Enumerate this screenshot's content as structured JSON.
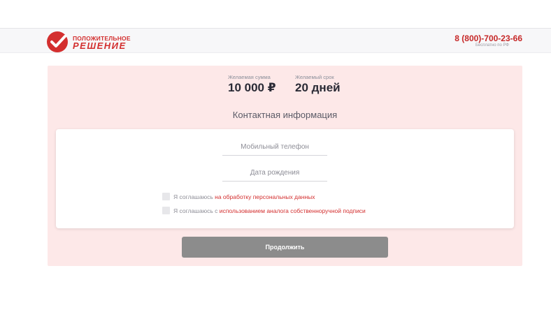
{
  "header": {
    "logo_line1": "ПОЛОЖИТЕЛЬНОЕ",
    "logo_line2": "РЕШЕНИЕ",
    "phone": "8 (800)-700-23-66",
    "phone_note": "Бесплатно по РФ",
    "brand_color": "#d32f2f"
  },
  "summary": {
    "amount_label": "Желаемая сумма",
    "amount_value": "10 000 ₽",
    "term_label": "Желаемый срок",
    "term_value": "20 дней"
  },
  "section_title": "Контактная информация",
  "form": {
    "phone_placeholder": "Мобильный телефон",
    "birth_placeholder": "Дата рождения",
    "consent1_prefix": "Я соглашаюсь ",
    "consent1_link": "на обработку персональных данных",
    "consent2_prefix": "Я соглашаюсь с ",
    "consent2_link": "использованием аналога собственноручной подписи"
  },
  "continue_label": "Продолжить",
  "colors": {
    "panel_bg": "#fde8e8",
    "button_bg": "#8c8c8c"
  }
}
